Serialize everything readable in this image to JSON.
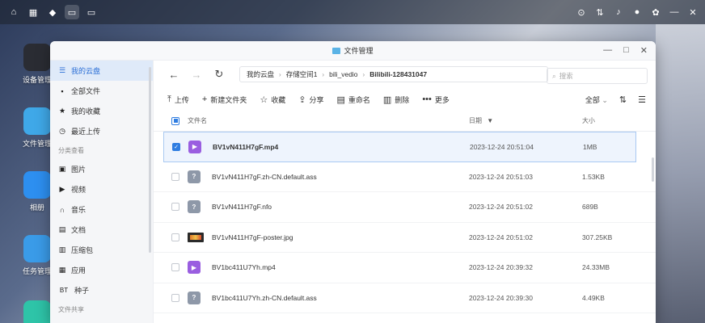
{
  "desktop": {
    "icons": [
      {
        "label": "设备管理"
      },
      {
        "label": "文件管理"
      },
      {
        "label": "相册"
      },
      {
        "label": "任务管理"
      }
    ]
  },
  "window": {
    "title": "文件管理",
    "nav": {
      "breadcrumb": [
        "我的云盘",
        "存储空间1",
        "bili_vedio",
        "Bilibili-128431047"
      ],
      "search_placeholder": "搜索"
    },
    "toolbar": {
      "upload": "上传",
      "new_folder": "新建文件夹",
      "favorite": "收藏",
      "share": "分享",
      "rename": "重命名",
      "delete": "删除",
      "more": "更多",
      "scope": "全部"
    },
    "sidebar": {
      "items": [
        {
          "label": "我的云盘",
          "icon": "list-icon",
          "glyph": "☰"
        },
        {
          "label": "全部文件",
          "icon": "file-icon",
          "glyph": "▪"
        },
        {
          "label": "我的收藏",
          "icon": "star-icon",
          "glyph": "★"
        },
        {
          "label": "最近上传",
          "icon": "clock-icon",
          "glyph": "◷"
        }
      ],
      "section_categories": "分类查看",
      "categories": [
        {
          "label": "图片",
          "icon": "image-icon",
          "glyph": "▣"
        },
        {
          "label": "视频",
          "icon": "video-icon",
          "glyph": "▶"
        },
        {
          "label": "音乐",
          "icon": "headphones-icon",
          "glyph": "∩"
        },
        {
          "label": "文档",
          "icon": "document-icon",
          "glyph": "▤"
        },
        {
          "label": "压缩包",
          "icon": "archive-icon",
          "glyph": "▥"
        },
        {
          "label": "应用",
          "icon": "apps-icon",
          "glyph": "▦"
        },
        {
          "label": "种子",
          "icon": "bt-icon",
          "glyph": "BT"
        }
      ],
      "section_share": "文件共享"
    },
    "table": {
      "headers": {
        "name": "文件名",
        "date": "日期",
        "size": "大小"
      },
      "rows": [
        {
          "name": "BV1vN411H7gF.mp4",
          "date": "2023-12-24 20:51:04",
          "size": "1MB",
          "type": "video",
          "selected": true
        },
        {
          "name": "BV1vN411H7gF.zh-CN.default.ass",
          "date": "2023-12-24 20:51:03",
          "size": "1.53KB",
          "type": "unknown",
          "selected": false
        },
        {
          "name": "BV1vN411H7gF.nfo",
          "date": "2023-12-24 20:51:02",
          "size": "689B",
          "type": "unknown",
          "selected": false
        },
        {
          "name": "BV1vN411H7gF-poster.jpg",
          "date": "2023-12-24 20:51:02",
          "size": "307.25KB",
          "type": "image",
          "selected": false
        },
        {
          "name": "BV1bc411U7Yh.mp4",
          "date": "2023-12-24 20:39:32",
          "size": "24.33MB",
          "type": "video",
          "selected": false
        },
        {
          "name": "BV1bc411U7Yh.zh-CN.default.ass",
          "date": "2023-12-24 20:39:30",
          "size": "4.49KB",
          "type": "unknown",
          "selected": false
        }
      ]
    }
  }
}
